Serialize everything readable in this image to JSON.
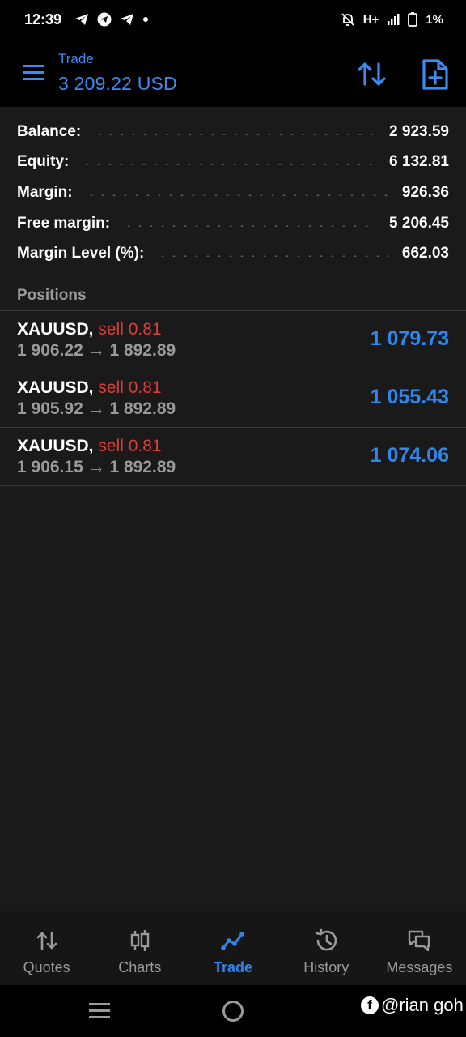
{
  "status_bar": {
    "time": "12:39",
    "network": "H+",
    "battery": "1%"
  },
  "toolbar": {
    "title": "Trade",
    "subtitle": "3 209.22 USD",
    "accent": "#3d8bf0"
  },
  "summary": [
    {
      "label": "Balance:",
      "value": "2 923.59"
    },
    {
      "label": "Equity:",
      "value": "6 132.81"
    },
    {
      "label": "Margin:",
      "value": "926.36"
    },
    {
      "label": "Free margin:",
      "value": "5 206.45"
    },
    {
      "label": "Margin Level (%):",
      "value": "662.03"
    }
  ],
  "positions": {
    "header": "Positions",
    "items": [
      {
        "symbol": "XAUUSD,",
        "side": "sell 0.81",
        "open_price": "1 906.22",
        "arrow": "→",
        "current_price": "1 892.89",
        "profit": "1 079.73"
      },
      {
        "symbol": "XAUUSD,",
        "side": "sell 0.81",
        "open_price": "1 905.92",
        "arrow": "→",
        "current_price": "1 892.89",
        "profit": "1 055.43"
      },
      {
        "symbol": "XAUUSD,",
        "side": "sell 0.81",
        "open_price": "1 906.15",
        "arrow": "→",
        "current_price": "1 892.89",
        "profit": "1 074.06"
      }
    ]
  },
  "bottom_nav": [
    {
      "label": "Quotes",
      "icon": "quotes-icon"
    },
    {
      "label": "Charts",
      "icon": "candlestick-icon"
    },
    {
      "label": "Trade",
      "icon": "trade-line-icon",
      "active": true
    },
    {
      "label": "History",
      "icon": "history-icon"
    },
    {
      "label": "Messages",
      "icon": "messages-icon"
    }
  ],
  "watermark": {
    "icon": "f",
    "text": "@rian goh"
  },
  "colors": {
    "profit": "#2f86ee",
    "sell": "#e23b36",
    "background": "#1a1a1a"
  }
}
